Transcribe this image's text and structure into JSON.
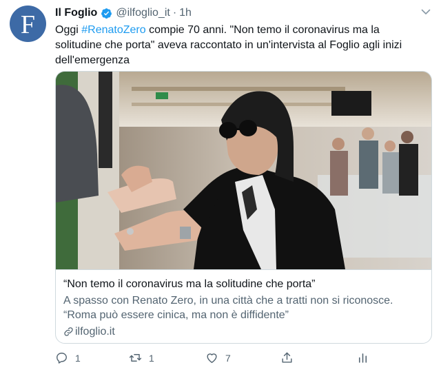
{
  "tweet": {
    "author": {
      "avatar_letter": "F",
      "name": "Il Foglio",
      "handle": "@ilfoglio_it",
      "separator": "·",
      "time": "1h",
      "verified_icon": "verified-badge-icon"
    },
    "text_prefix": "Oggi ",
    "hashtag": "#RenatoZero",
    "text_suffix": " compie 70 anni. \"Non temo il coronavirus ma la solitudine che porta\" aveva raccontato in un'intervista al Foglio agli inizi dell'emergenza",
    "card": {
      "title": "“Non temo il coronavirus ma la solitudine che porta”",
      "description": "A spasso con Renato Zero, in una città che a tratti non si riconosce. “Roma può essere cinica, ma non è diffidente”",
      "domain": "ilfoglio.it"
    },
    "actions": {
      "reply_count": "1",
      "retweet_count": "1",
      "like_count": "7"
    },
    "colors": {
      "accent": "#1d9bf0",
      "avatar_bg": "#3d6aa6",
      "muted": "#536471"
    }
  }
}
